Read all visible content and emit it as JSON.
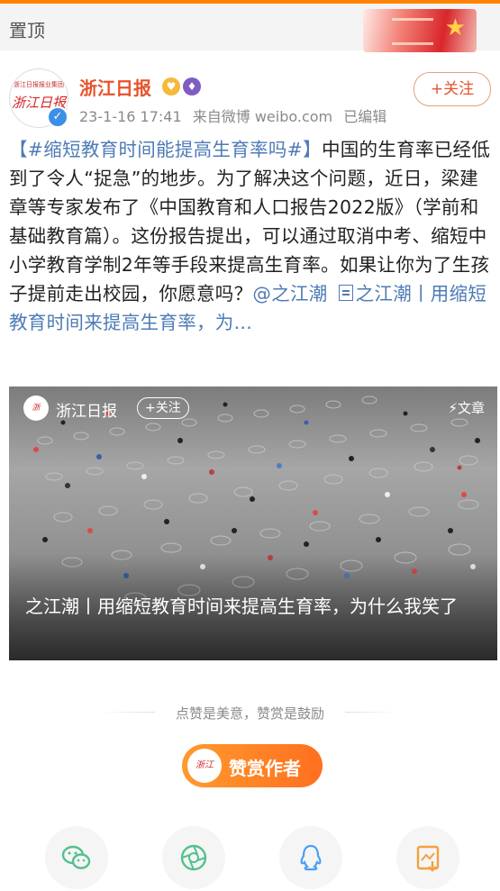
{
  "pinned": {
    "label": "置顶"
  },
  "header": {
    "avatar_small_text": "浙江日报报业集团",
    "avatar_logo": "浙江日报",
    "name": "浙江日报",
    "time": "23-1-16 17:41",
    "source": "来自微博 weibo.com",
    "edited": "已编辑",
    "follow_label": "+关注"
  },
  "post": {
    "hashtag": "【#缩短教育时间能提高生育率吗#】",
    "text": "中国的生育率已经低到了令人“捉急”的地步。为了解决这个问题，近日，梁建章等专家发布了《中国教育和人口报告2022版》（学前和基础教育篇）。这份报告提出，可以通过取消中考、缩短中小学教育学制2年等手段来提高生育率。如果让你为了生孩子提前走出校园，你愿意吗？",
    "mention": "@之江潮",
    "link_text": "之江潮丨用缩短教育时间来提高生育率，为..."
  },
  "card": {
    "name": "浙江日报",
    "follow_label": "+关注",
    "tag": "⚡文章",
    "title": "之江潮丨用缩短教育时间来提高生育率，为什么我笑了"
  },
  "reward": {
    "divider_text": "点赞是美意，赞赏是鼓励",
    "button_label": "赞赏作者"
  },
  "share_icons": [
    "wechat-icon",
    "moments-icon",
    "qq-icon",
    "save-image-icon"
  ],
  "colors": {
    "accent": "#ff8200",
    "link": "#4e7bb5",
    "name": "#e8532b",
    "wechat": "#54c08c",
    "qq": "#4a9ff5",
    "save": "#f2a23c"
  }
}
